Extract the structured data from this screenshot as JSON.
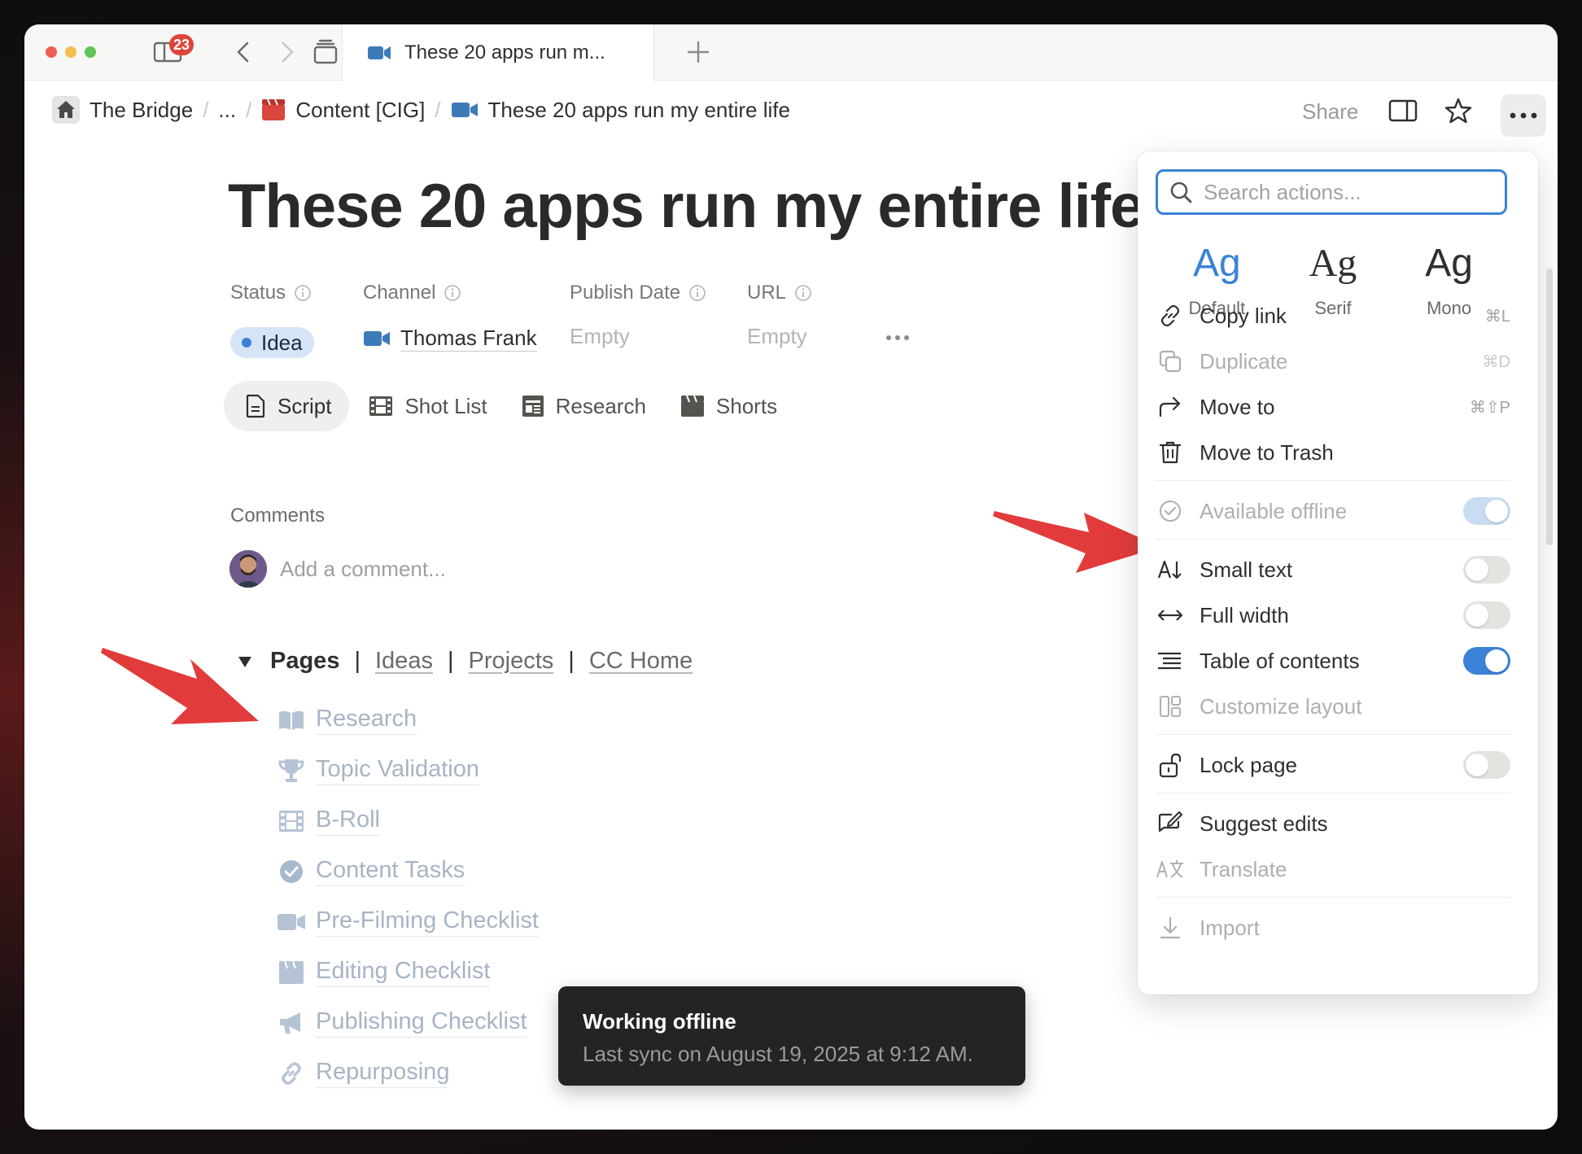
{
  "tabbar": {
    "badge": "23",
    "tab_title": "These 20 apps run m..."
  },
  "breadcrumb": {
    "home": "The Bridge",
    "ellipsis": "...",
    "parent": "Content [CIG]",
    "current": "These 20 apps run my entire life"
  },
  "topbar": {
    "share": "Share"
  },
  "page": {
    "title": "These 20 apps run my entire life",
    "props": {
      "status_label": "Status",
      "status_value": "Idea",
      "channel_label": "Channel",
      "channel_value": "Thomas Frank",
      "publish_label": "Publish Date",
      "publish_value": "Empty",
      "url_label": "URL",
      "url_value": "Empty"
    },
    "view_tabs": [
      "Script",
      "Shot List",
      "Research",
      "Shorts"
    ],
    "comments_label": "Comments",
    "add_comment_placeholder": "Add a comment...",
    "pages_nav": {
      "current": "Pages",
      "links": [
        "Ideas",
        "Projects",
        "CC Home"
      ],
      "separator": "|"
    },
    "pages": [
      {
        "label": "Research",
        "icon": "book-icon"
      },
      {
        "label": "Topic Validation",
        "icon": "trophy-icon"
      },
      {
        "label": "B-Roll",
        "icon": "film-icon"
      },
      {
        "label": "Content Tasks",
        "icon": "check-circle-icon"
      },
      {
        "label": "Pre-Filming Checklist",
        "icon": "video-camera-icon"
      },
      {
        "label": "Editing Checklist",
        "icon": "clapperboard-icon"
      },
      {
        "label": "Publishing Checklist",
        "icon": "megaphone-icon"
      },
      {
        "label": "Repurposing",
        "icon": "link-icon"
      }
    ]
  },
  "toast": {
    "title": "Working offline",
    "message": "Last sync on August 19, 2025 at 9:12 AM."
  },
  "menu": {
    "search_placeholder": "Search actions...",
    "fonts": [
      {
        "glyph": "Ag",
        "label": "Default",
        "selected": true
      },
      {
        "glyph": "Ag",
        "label": "Serif",
        "selected": false
      },
      {
        "glyph": "Ag",
        "label": "Mono",
        "selected": false
      }
    ],
    "copy_link": {
      "label": "Copy link",
      "shortcut": "⌘L"
    },
    "duplicate": {
      "label": "Duplicate",
      "shortcut": "⌘D"
    },
    "move_to": {
      "label": "Move to",
      "shortcut": "⌘⇧P"
    },
    "move_to_trash": {
      "label": "Move to Trash"
    },
    "available_offline": {
      "label": "Available offline",
      "on": true
    },
    "small_text": {
      "label": "Small text",
      "on": false
    },
    "full_width": {
      "label": "Full width",
      "on": false
    },
    "table_of_contents": {
      "label": "Table of contents",
      "on": true
    },
    "customize_layout": {
      "label": "Customize layout"
    },
    "lock_page": {
      "label": "Lock page",
      "on": false
    },
    "suggest_edits": {
      "label": "Suggest edits"
    },
    "translate": {
      "label": "Translate"
    },
    "import": {
      "label": "Import"
    }
  },
  "colors": {
    "accent": "#3b82d6",
    "badge": "#e0433a",
    "annotation_arrow": "#e23b3b"
  }
}
